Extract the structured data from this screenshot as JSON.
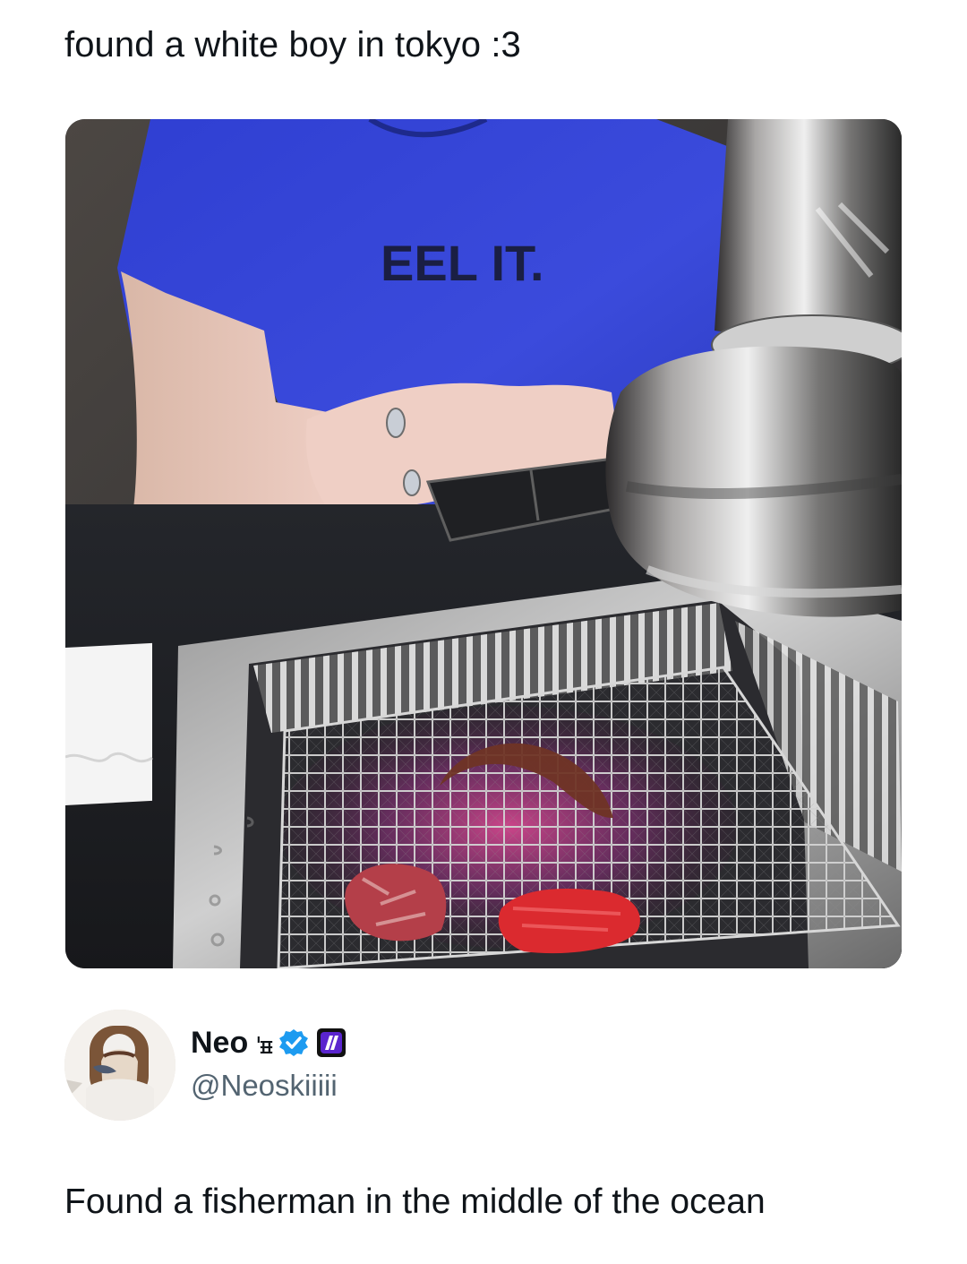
{
  "post": {
    "caption": "found a white boy in tokyo :3",
    "author": {
      "display_name": "Neo",
      "name_decoration": "'ᵻᵻ",
      "username": "@Neoskiiiii",
      "verified": true,
      "icons": {
        "avatar": "profile-photo",
        "verified": "verified-badge-icon",
        "affiliate": "affiliate-badge-icon"
      }
    },
    "quote_text": "Found a fisherman in the middle of the ocean"
  },
  "colors": {
    "text_primary": "#0f1419",
    "text_secondary": "#536471",
    "verified_blue": "#1d9bf0",
    "affiliate_purple": "#6d28d9",
    "shirt_blue": "#3442c8",
    "steel": "#b8b8b8",
    "meat_red": "#c72828"
  }
}
